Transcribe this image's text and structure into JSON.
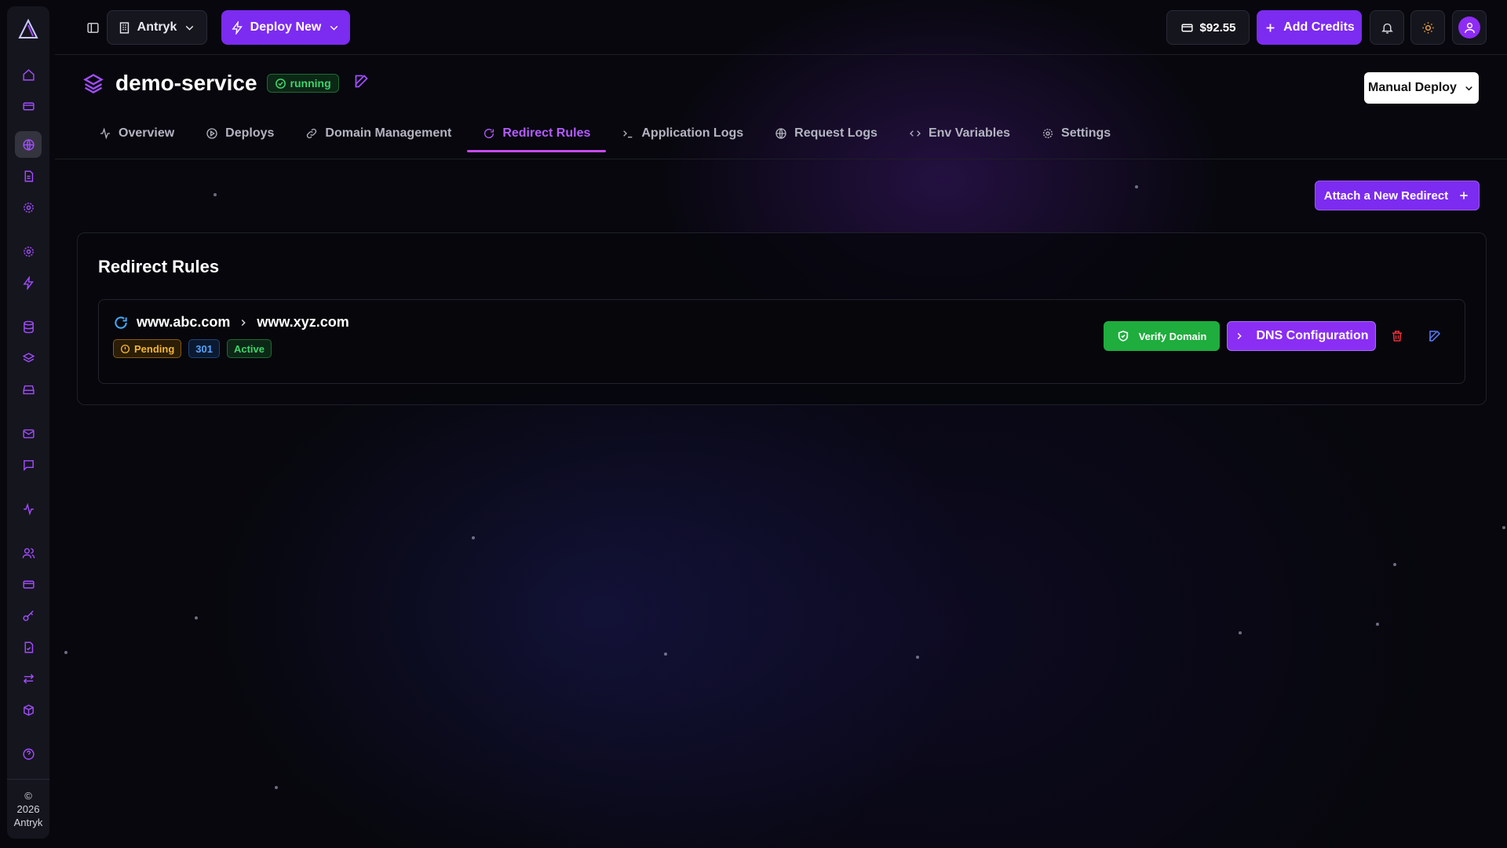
{
  "app": {
    "name": "Antryk",
    "footer": [
      "©",
      "2026",
      "Antryk"
    ],
    "accent_color": "#7c2bf0"
  },
  "topbar": {
    "org_name": "Antryk",
    "deploy_new_label": "Deploy New",
    "credits_amount": "$92.55",
    "add_credits_label": "Add Credits"
  },
  "sidebar": {
    "icons": [
      "home-icon",
      "billing-icon",
      "globe-icon",
      "file-icon",
      "settings-icon",
      "settings-alt-icon",
      "bolt-icon",
      "database-icon",
      "layers-icon",
      "drive-icon",
      "mail-icon",
      "chat-icon",
      "activity-icon",
      "users-icon",
      "card-icon",
      "key-icon",
      "file-check-icon",
      "transfer-icon",
      "package-icon",
      "help-icon"
    ],
    "active_icon": "globe-icon"
  },
  "service": {
    "name": "demo-service",
    "status": "running",
    "manual_deploy_label": "Manual Deploy"
  },
  "tabs": [
    {
      "label": "Overview",
      "icon": "activity-icon"
    },
    {
      "label": "Deploys",
      "icon": "play-icon"
    },
    {
      "label": "Domain Management",
      "icon": "link-icon"
    },
    {
      "label": "Redirect Rules",
      "icon": "refresh-icon",
      "active": true
    },
    {
      "label": "Application Logs",
      "icon": "terminal-icon"
    },
    {
      "label": "Request Logs",
      "icon": "globe-icon"
    },
    {
      "label": "Env Variables",
      "icon": "code-icon"
    },
    {
      "label": "Settings",
      "icon": "gear-icon"
    }
  ],
  "redirects": {
    "attach_label": "Attach a New Redirect",
    "section_title": "Redirect Rules",
    "rules": [
      {
        "source": "www.abc.com",
        "target": "www.xyz.com",
        "status": "Pending",
        "code": "301",
        "state": "Active",
        "verify_label": "Verify Domain",
        "dns_label": "DNS Configuration"
      }
    ]
  }
}
